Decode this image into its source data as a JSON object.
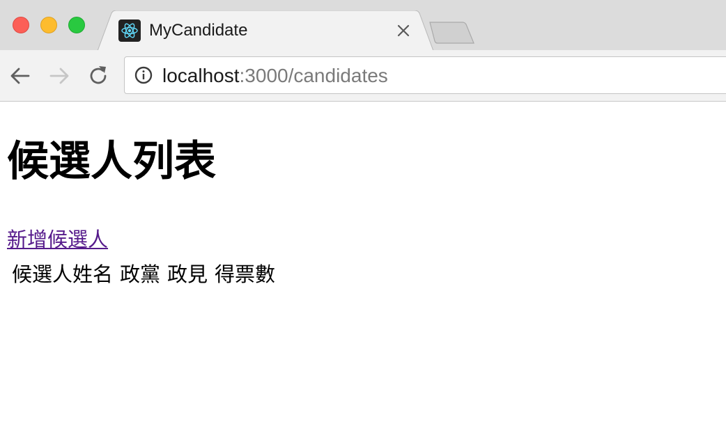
{
  "browser": {
    "tab": {
      "title": "MyCandidate",
      "favicon": "react-logo-icon"
    },
    "address_bar": {
      "host": "localhost",
      "path": ":3000/candidates"
    }
  },
  "page": {
    "title": "候選人列表",
    "add_candidate_link": "新增候選人",
    "table": {
      "columns": [
        "候選人姓名",
        "政黨",
        "政見",
        "得票數"
      ],
      "rows": []
    }
  },
  "colors": {
    "link_visited": "#551a8b",
    "tab_bar": "#dcdcdc",
    "toolbar": "#f2f2f2",
    "react_accent": "#61dafb"
  }
}
